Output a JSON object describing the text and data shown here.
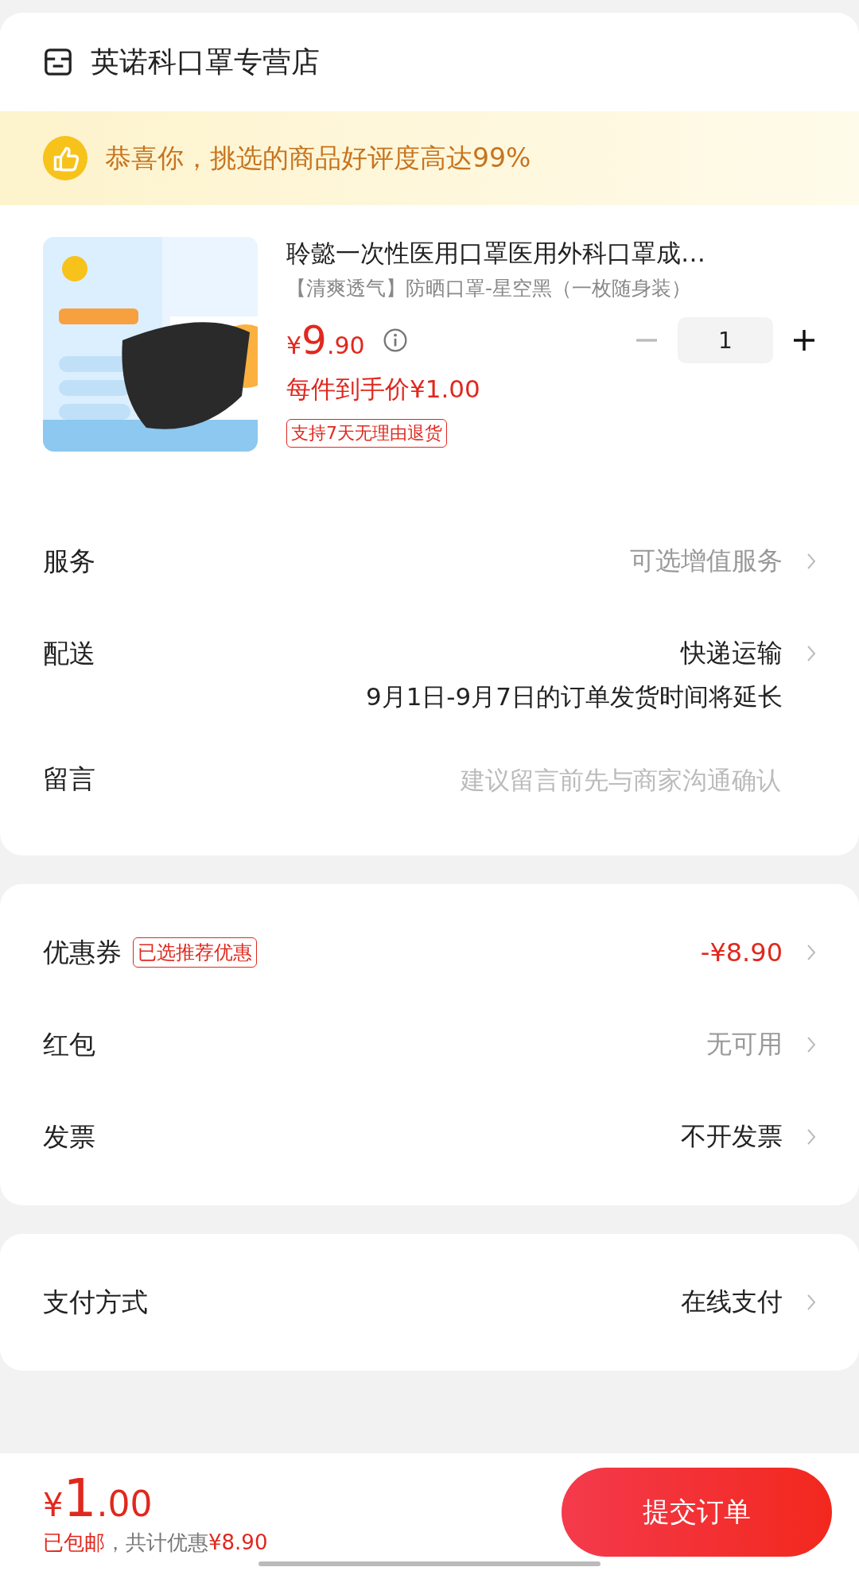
{
  "store": {
    "name": "英诺科口罩专营店"
  },
  "banner": {
    "text": "恭喜你，挑选的商品好评度高达99%"
  },
  "product": {
    "title": "聆懿一次性医用口罩医用外科口罩成…",
    "spec": "【清爽透气】防晒口罩-星空黑（一枚随身装）",
    "price": {
      "currency": "¥",
      "integer": "9",
      "decimal": ".90"
    },
    "unit_price": "每件到手价¥1.00",
    "quantity": "1",
    "minus_disabled": true,
    "tag": "支持7天无理由退货"
  },
  "order_rows": [
    {
      "kind": "link",
      "label": "服务",
      "value": "可选增值服务",
      "color": "#999999"
    },
    {
      "kind": "link",
      "label": "配送",
      "value": "快递运输",
      "color": "#222222",
      "note": "9月1日-9月7日的订单发货时间将延长"
    },
    {
      "kind": "input",
      "label": "留言",
      "placeholder": "建议留言前先与商家沟通确认"
    }
  ],
  "discount_rows": [
    {
      "kind": "link",
      "label": "优惠券",
      "tag": "已选推荐优惠",
      "value": "-¥8.90",
      "color": "#e0281e"
    },
    {
      "kind": "link",
      "label": "红包",
      "value": "无可用",
      "color": "#999999"
    },
    {
      "kind": "link",
      "label": "发票",
      "value": "不开发票",
      "color": "#222222"
    }
  ],
  "payment_rows": [
    {
      "kind": "link",
      "label": "支付方式",
      "value": "在线支付",
      "color": "#222222"
    }
  ],
  "footer": {
    "total": {
      "currency": "¥",
      "integer": "1",
      "decimal": ".00"
    },
    "summary": [
      {
        "text": "已包邮",
        "accent": true
      },
      {
        "text": "，共计优惠",
        "accent": false
      },
      {
        "text": "¥8.90",
        "accent": true
      }
    ],
    "submit": "提交订单"
  }
}
